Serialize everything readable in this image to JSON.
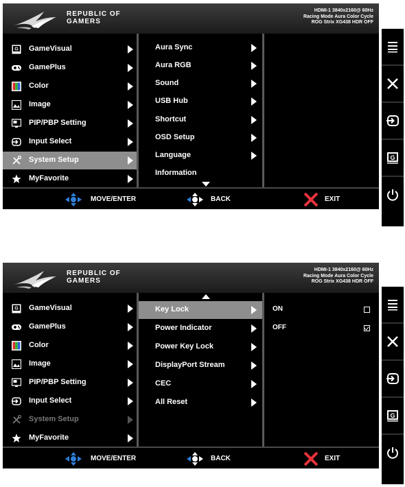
{
  "brand": {
    "line1": "REPUBLIC OF",
    "line2": "GAMERS"
  },
  "status": {
    "line1": "HDMI-1  3840x2160@ 60Hz",
    "line2": "Racing Mode  Aura Color Cycle",
    "line3": "ROG Strix XG438 HDR OFF"
  },
  "main_menu": [
    {
      "label": "GameVisual",
      "icon": "gamevisual-icon"
    },
    {
      "label": "GamePlus",
      "icon": "gameplus-icon"
    },
    {
      "label": "Color",
      "icon": "color-icon"
    },
    {
      "label": "Image",
      "icon": "image-icon"
    },
    {
      "label": "PIP/PBP Setting",
      "icon": "pip-icon"
    },
    {
      "label": "Input Select",
      "icon": "input-select-icon"
    },
    {
      "label": "System Setup",
      "icon": "system-setup-icon"
    },
    {
      "label": "MyFavorite",
      "icon": "star-icon"
    }
  ],
  "system_menu_1": [
    "Aura Sync",
    "Aura RGB",
    "Sound",
    "USB Hub",
    "Shortcut",
    "OSD Setup",
    "Language",
    "Information"
  ],
  "system_menu_2": [
    "Key Lock",
    "Power Indicator",
    "Power Key Lock",
    "DisplayPort Stream",
    "CEC",
    "All Reset"
  ],
  "options": [
    {
      "label": "ON",
      "checked": false
    },
    {
      "label": "OFF",
      "checked": true
    }
  ],
  "footer": {
    "move": "MOVE/ENTER",
    "back": "BACK",
    "exit": "EXIT"
  },
  "side_buttons": [
    "menu-icon",
    "close-icon",
    "input-icon",
    "gamevisual-icon",
    "power-icon"
  ],
  "colors": {
    "selected": "#8e8e8e",
    "exit_red": "#e8323c",
    "nav_blue": "#2f7fd8"
  }
}
